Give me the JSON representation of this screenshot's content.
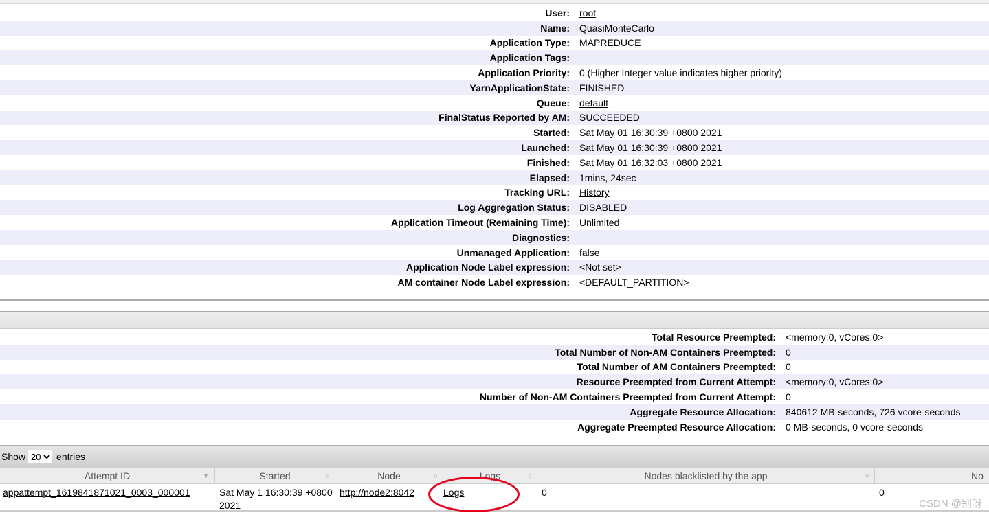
{
  "overview": [
    {
      "label": "User:",
      "value": "root",
      "link": true
    },
    {
      "label": "Name:",
      "value": "QuasiMonteCarlo"
    },
    {
      "label": "Application Type:",
      "value": "MAPREDUCE"
    },
    {
      "label": "Application Tags:",
      "value": ""
    },
    {
      "label": "Application Priority:",
      "value": "0 (Higher Integer value indicates higher priority)"
    },
    {
      "label": "YarnApplicationState:",
      "value": "FINISHED"
    },
    {
      "label": "Queue:",
      "value": "default",
      "link": true
    },
    {
      "label": "FinalStatus Reported by AM:",
      "value": "SUCCEEDED"
    },
    {
      "label": "Started:",
      "value": "Sat May 01 16:30:39 +0800 2021"
    },
    {
      "label": "Launched:",
      "value": "Sat May 01 16:30:39 +0800 2021"
    },
    {
      "label": "Finished:",
      "value": "Sat May 01 16:32:03 +0800 2021"
    },
    {
      "label": "Elapsed:",
      "value": "1mins, 24sec"
    },
    {
      "label": "Tracking URL:",
      "value": "History",
      "link": true
    },
    {
      "label": "Log Aggregation Status:",
      "value": "DISABLED"
    },
    {
      "label": "Application Timeout (Remaining Time):",
      "value": "Unlimited"
    },
    {
      "label": "Diagnostics:",
      "value": ""
    },
    {
      "label": "Unmanaged Application:",
      "value": "false"
    },
    {
      "label": "Application Node Label expression:",
      "value": "<Not set>"
    },
    {
      "label": "AM container Node Label expression:",
      "value": "<DEFAULT_PARTITION>"
    }
  ],
  "metrics": [
    {
      "label": "Total Resource Preempted:",
      "value": "<memory:0, vCores:0>"
    },
    {
      "label": "Total Number of Non-AM Containers Preempted:",
      "value": "0"
    },
    {
      "label": "Total Number of AM Containers Preempted:",
      "value": "0"
    },
    {
      "label": "Resource Preempted from Current Attempt:",
      "value": "<memory:0, vCores:0>"
    },
    {
      "label": "Number of Non-AM Containers Preempted from Current Attempt:",
      "value": "0"
    },
    {
      "label": "Aggregate Resource Allocation:",
      "value": "840612 MB-seconds, 726 vcore-seconds"
    },
    {
      "label": "Aggregate Preempted Resource Allocation:",
      "value": "0 MB-seconds, 0 vcore-seconds"
    }
  ],
  "attempts": {
    "show_label": "Show",
    "entries_label": "entries",
    "page_size": "20",
    "columns": [
      "Attempt ID",
      "Started",
      "Node",
      "Logs",
      "Nodes blacklisted by the app",
      "No"
    ],
    "rows": [
      {
        "id": "appattempt_1619841871021_0003_000001",
        "started": "Sat May 1 16:30:39 +0800 2021",
        "node": "http://node2:8042",
        "logs": "Logs",
        "blacklisted_app": "0",
        "blacklisted_system": "0"
      }
    ]
  },
  "annotation_color": "#e8001c",
  "watermark": "CSDN @别呀"
}
